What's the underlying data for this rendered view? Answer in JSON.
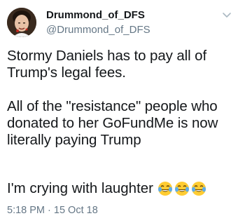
{
  "tweet": {
    "display_name": "Drummond_of_DFS",
    "handle": "@Drummond_of_DFS",
    "paragraph1": "Stormy Daniels has to pay all of Trump's legal fees.",
    "paragraph2": "All of the \"resistance\" people who donated to her GoFundMe is now literally paying Trump",
    "paragraph3": "I'm crying with laughter",
    "emojis": [
      "face-with-tears-of-joy",
      "face-with-tears-of-joy",
      "face-with-tears-of-joy"
    ],
    "timestamp": "5:18 PM · 15 Oct 18"
  },
  "colors": {
    "text": "#14171a",
    "secondary": "#657786",
    "emoji_face": "#ffcc33",
    "emoji_tears": "#5dadec"
  },
  "icons": {
    "menu": "chevron-down-icon",
    "avatar": "profile-avatar"
  }
}
